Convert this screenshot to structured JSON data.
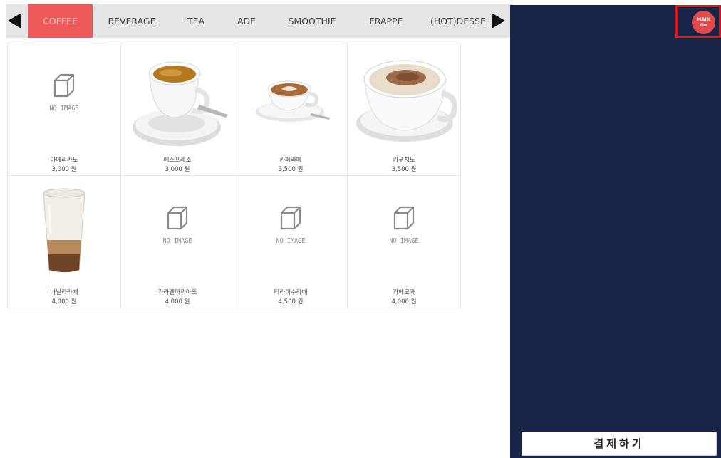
{
  "tabs": [
    {
      "label": "COFFEE",
      "active": true
    },
    {
      "label": "BEVERAGE",
      "active": false
    },
    {
      "label": "TEA",
      "active": false
    },
    {
      "label": "ADE",
      "active": false
    },
    {
      "label": "SMOOTHIE",
      "active": false
    },
    {
      "label": "FRAPPE",
      "active": false
    },
    {
      "label": "(HOT)DESSE",
      "active": false
    }
  ],
  "no_image_text": "NO IMAGE",
  "products": [
    {
      "name": "아메리카노",
      "price": "3,000 원",
      "image": "no-image"
    },
    {
      "name": "에스프레소",
      "price": "3,000 원",
      "image": "espresso-cup"
    },
    {
      "name": "카페라떼",
      "price": "3,500 원",
      "image": "latte-cup"
    },
    {
      "name": "카푸치노",
      "price": "3,500 원",
      "image": "cappuccino-cup"
    },
    {
      "name": "바닐라라떼",
      "price": "4,000 원",
      "image": "iced-latte-glass"
    },
    {
      "name": "카라멜마끼아또",
      "price": "4,000 원",
      "image": "no-image"
    },
    {
      "name": "티라미수라떼",
      "price": "4,500 원",
      "image": "no-image"
    },
    {
      "name": "카페모카",
      "price": "4,000 원",
      "image": "no-image"
    }
  ],
  "main_go": {
    "line1": "MAIN",
    "line2": "Go"
  },
  "pay_button": "결제하기",
  "colors": {
    "active_tab": "#ee5a59",
    "sidebar": "#182447",
    "highlight": "#e8130e"
  }
}
